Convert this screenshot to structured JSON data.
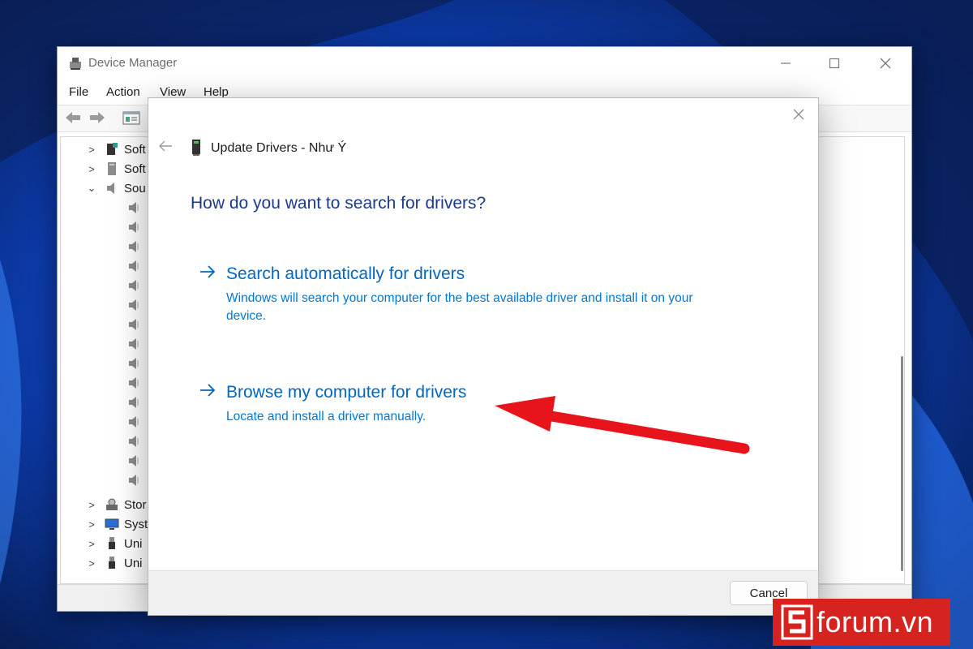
{
  "device_manager": {
    "title": "Device Manager",
    "menu": [
      "File",
      "Action",
      "View",
      "Help"
    ],
    "tree": [
      {
        "label": "Soft",
        "expanded": false,
        "icon": "software-component-icon"
      },
      {
        "label": "Soft",
        "expanded": false,
        "icon": "software-device-icon"
      },
      {
        "label": "Sou",
        "expanded": true,
        "icon": "speaker-icon"
      },
      {
        "label": "Stor",
        "expanded": false,
        "icon": "storage-controller-icon"
      },
      {
        "label": "Syst",
        "expanded": false,
        "icon": "system-devices-icon"
      },
      {
        "label": "Uni",
        "expanded": false,
        "icon": "usb-icon"
      },
      {
        "label": "Uni",
        "expanded": false,
        "icon": "usb-icon"
      }
    ],
    "sound_child_count": 15
  },
  "dialog": {
    "title": "Update Drivers - Như Ý",
    "heading": "How do you want to search for drivers?",
    "options": [
      {
        "title": "Search automatically for drivers",
        "description": "Windows will search your computer for the best available driver and install it on your device."
      },
      {
        "title": "Browse my computer for drivers",
        "description": "Locate and install a driver manually."
      }
    ],
    "cancel_label": "Cancel"
  },
  "watermark": {
    "text": "forum.vn"
  },
  "colors": {
    "link": "#0067c0",
    "heading": "#1a3a8a",
    "annotation": "#e8141c",
    "watermark_bg": "#d7231f"
  }
}
